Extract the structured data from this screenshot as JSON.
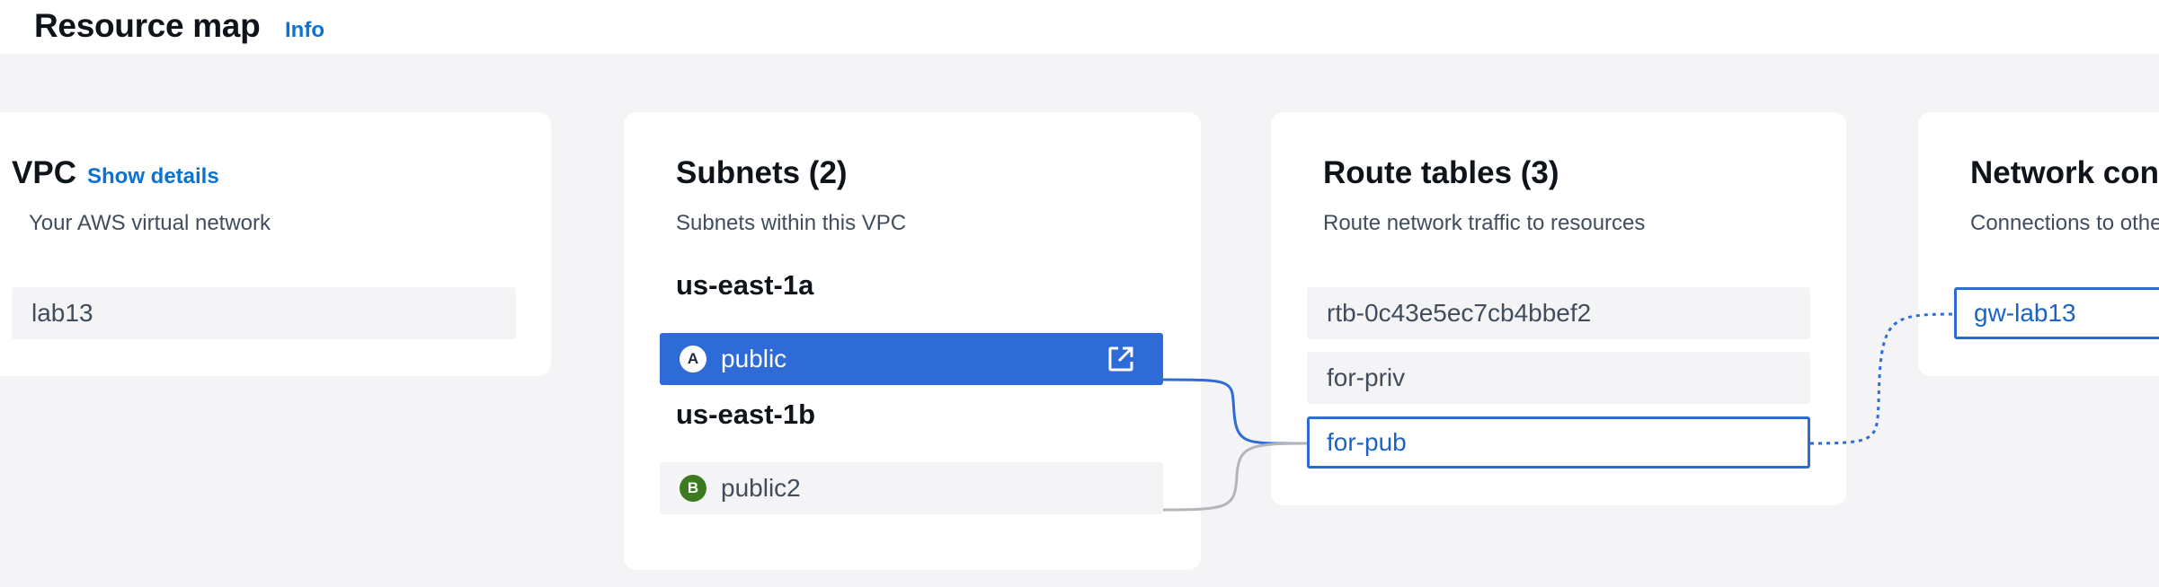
{
  "header": {
    "title": "Resource map",
    "info_label": "Info"
  },
  "vpc": {
    "title": "VPC",
    "show_details_label": "Show details",
    "subtitle": "Your AWS virtual network",
    "items": [
      "lab13"
    ]
  },
  "subnets": {
    "title": "Subnets (2)",
    "subtitle": "Subnets within this VPC",
    "zones": [
      {
        "label": "us-east-1a",
        "subnet": {
          "badge": "A",
          "name": "public",
          "selected": true
        }
      },
      {
        "label": "us-east-1b",
        "subnet": {
          "badge": "B",
          "name": "public2",
          "selected": false
        }
      }
    ]
  },
  "route_tables": {
    "title": "Route tables (3)",
    "subtitle": "Route network traffic to resources",
    "items": [
      "rtb-0c43e5ec7cb4bbef2",
      "for-priv",
      "for-pub"
    ]
  },
  "network_connections": {
    "title": "Network con",
    "subtitle": "Connections to othe",
    "items": [
      "gw-lab13"
    ]
  },
  "colors": {
    "accent": "#2f6bd6",
    "link": "#0972d3",
    "canvas_bg": "#f4f4f6",
    "card_bg": "#ffffff",
    "connector_gray": "#b4b4bb",
    "badge_b": "#3b7a1f"
  }
}
